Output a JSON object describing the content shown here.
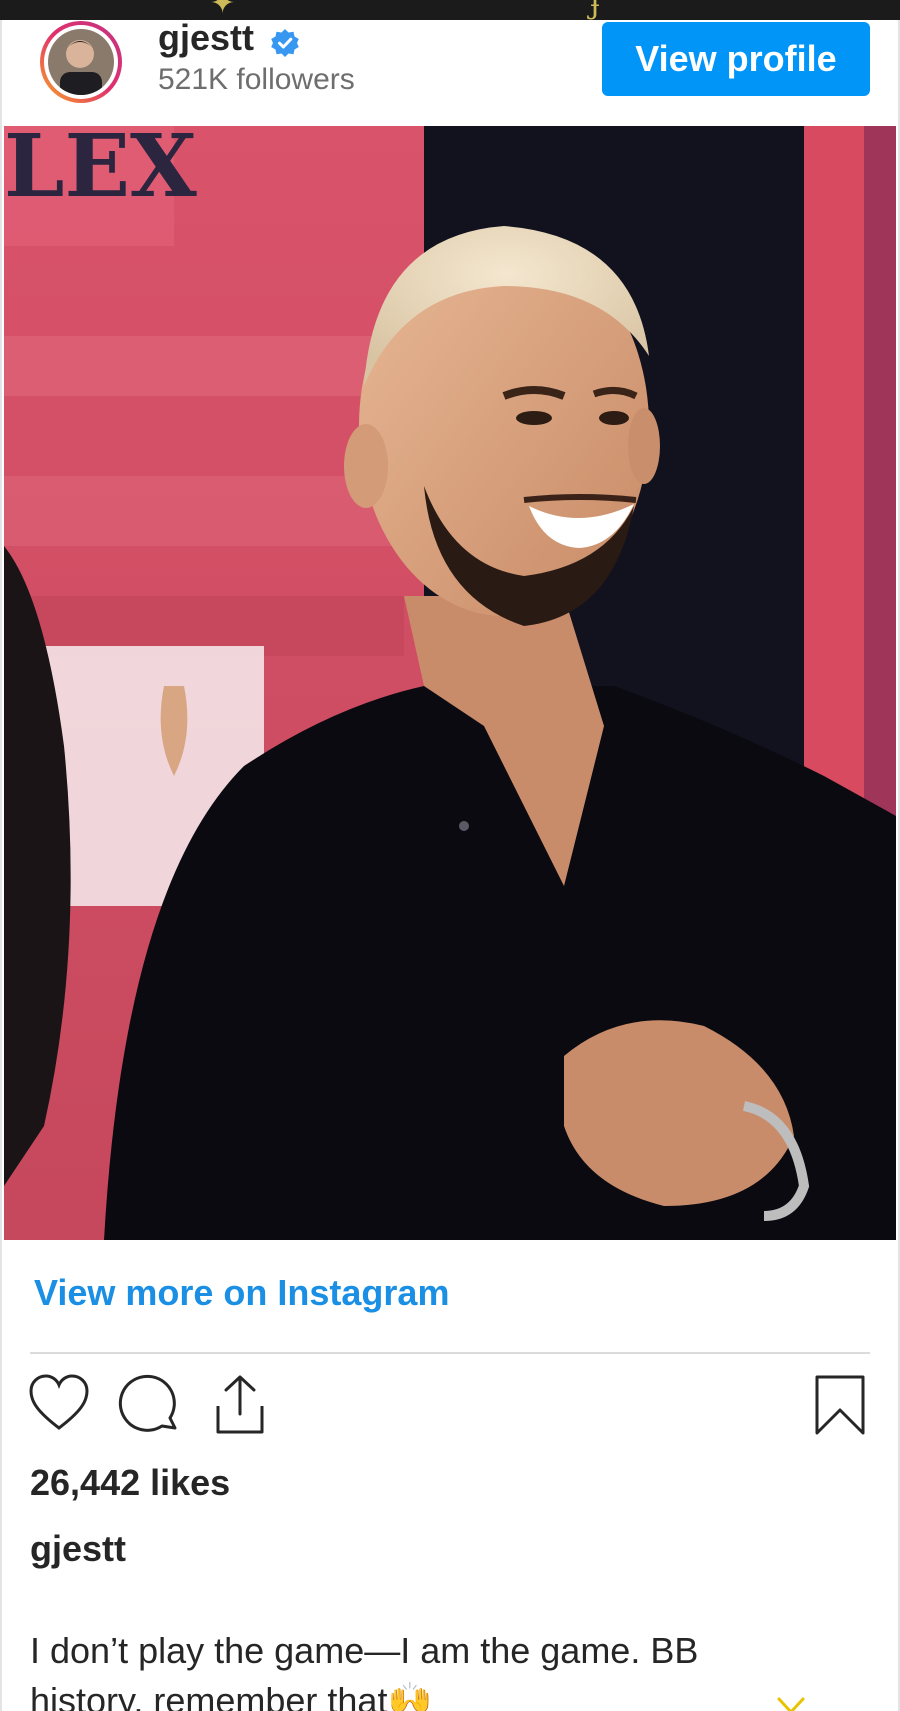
{
  "post": {
    "username": "gjestt",
    "followers": "521K followers",
    "view_profile_label": "View profile",
    "view_more_label": "View more on Instagram",
    "likes": "26,442 likes",
    "caption_user": "gjestt",
    "caption_text": "I don’t play the game—I am the game. BB history, remember that🙌"
  },
  "photo": {
    "sign_text": "LEX"
  },
  "colors": {
    "accent": "#0095f6",
    "link": "#1a8fe3",
    "verified": "#3897f0"
  },
  "icons": {
    "like": "heart-icon",
    "comment": "comment-icon",
    "share": "share-icon",
    "save": "bookmark-icon",
    "verified": "verified-badge-icon",
    "more": "chevron-down-icon"
  }
}
